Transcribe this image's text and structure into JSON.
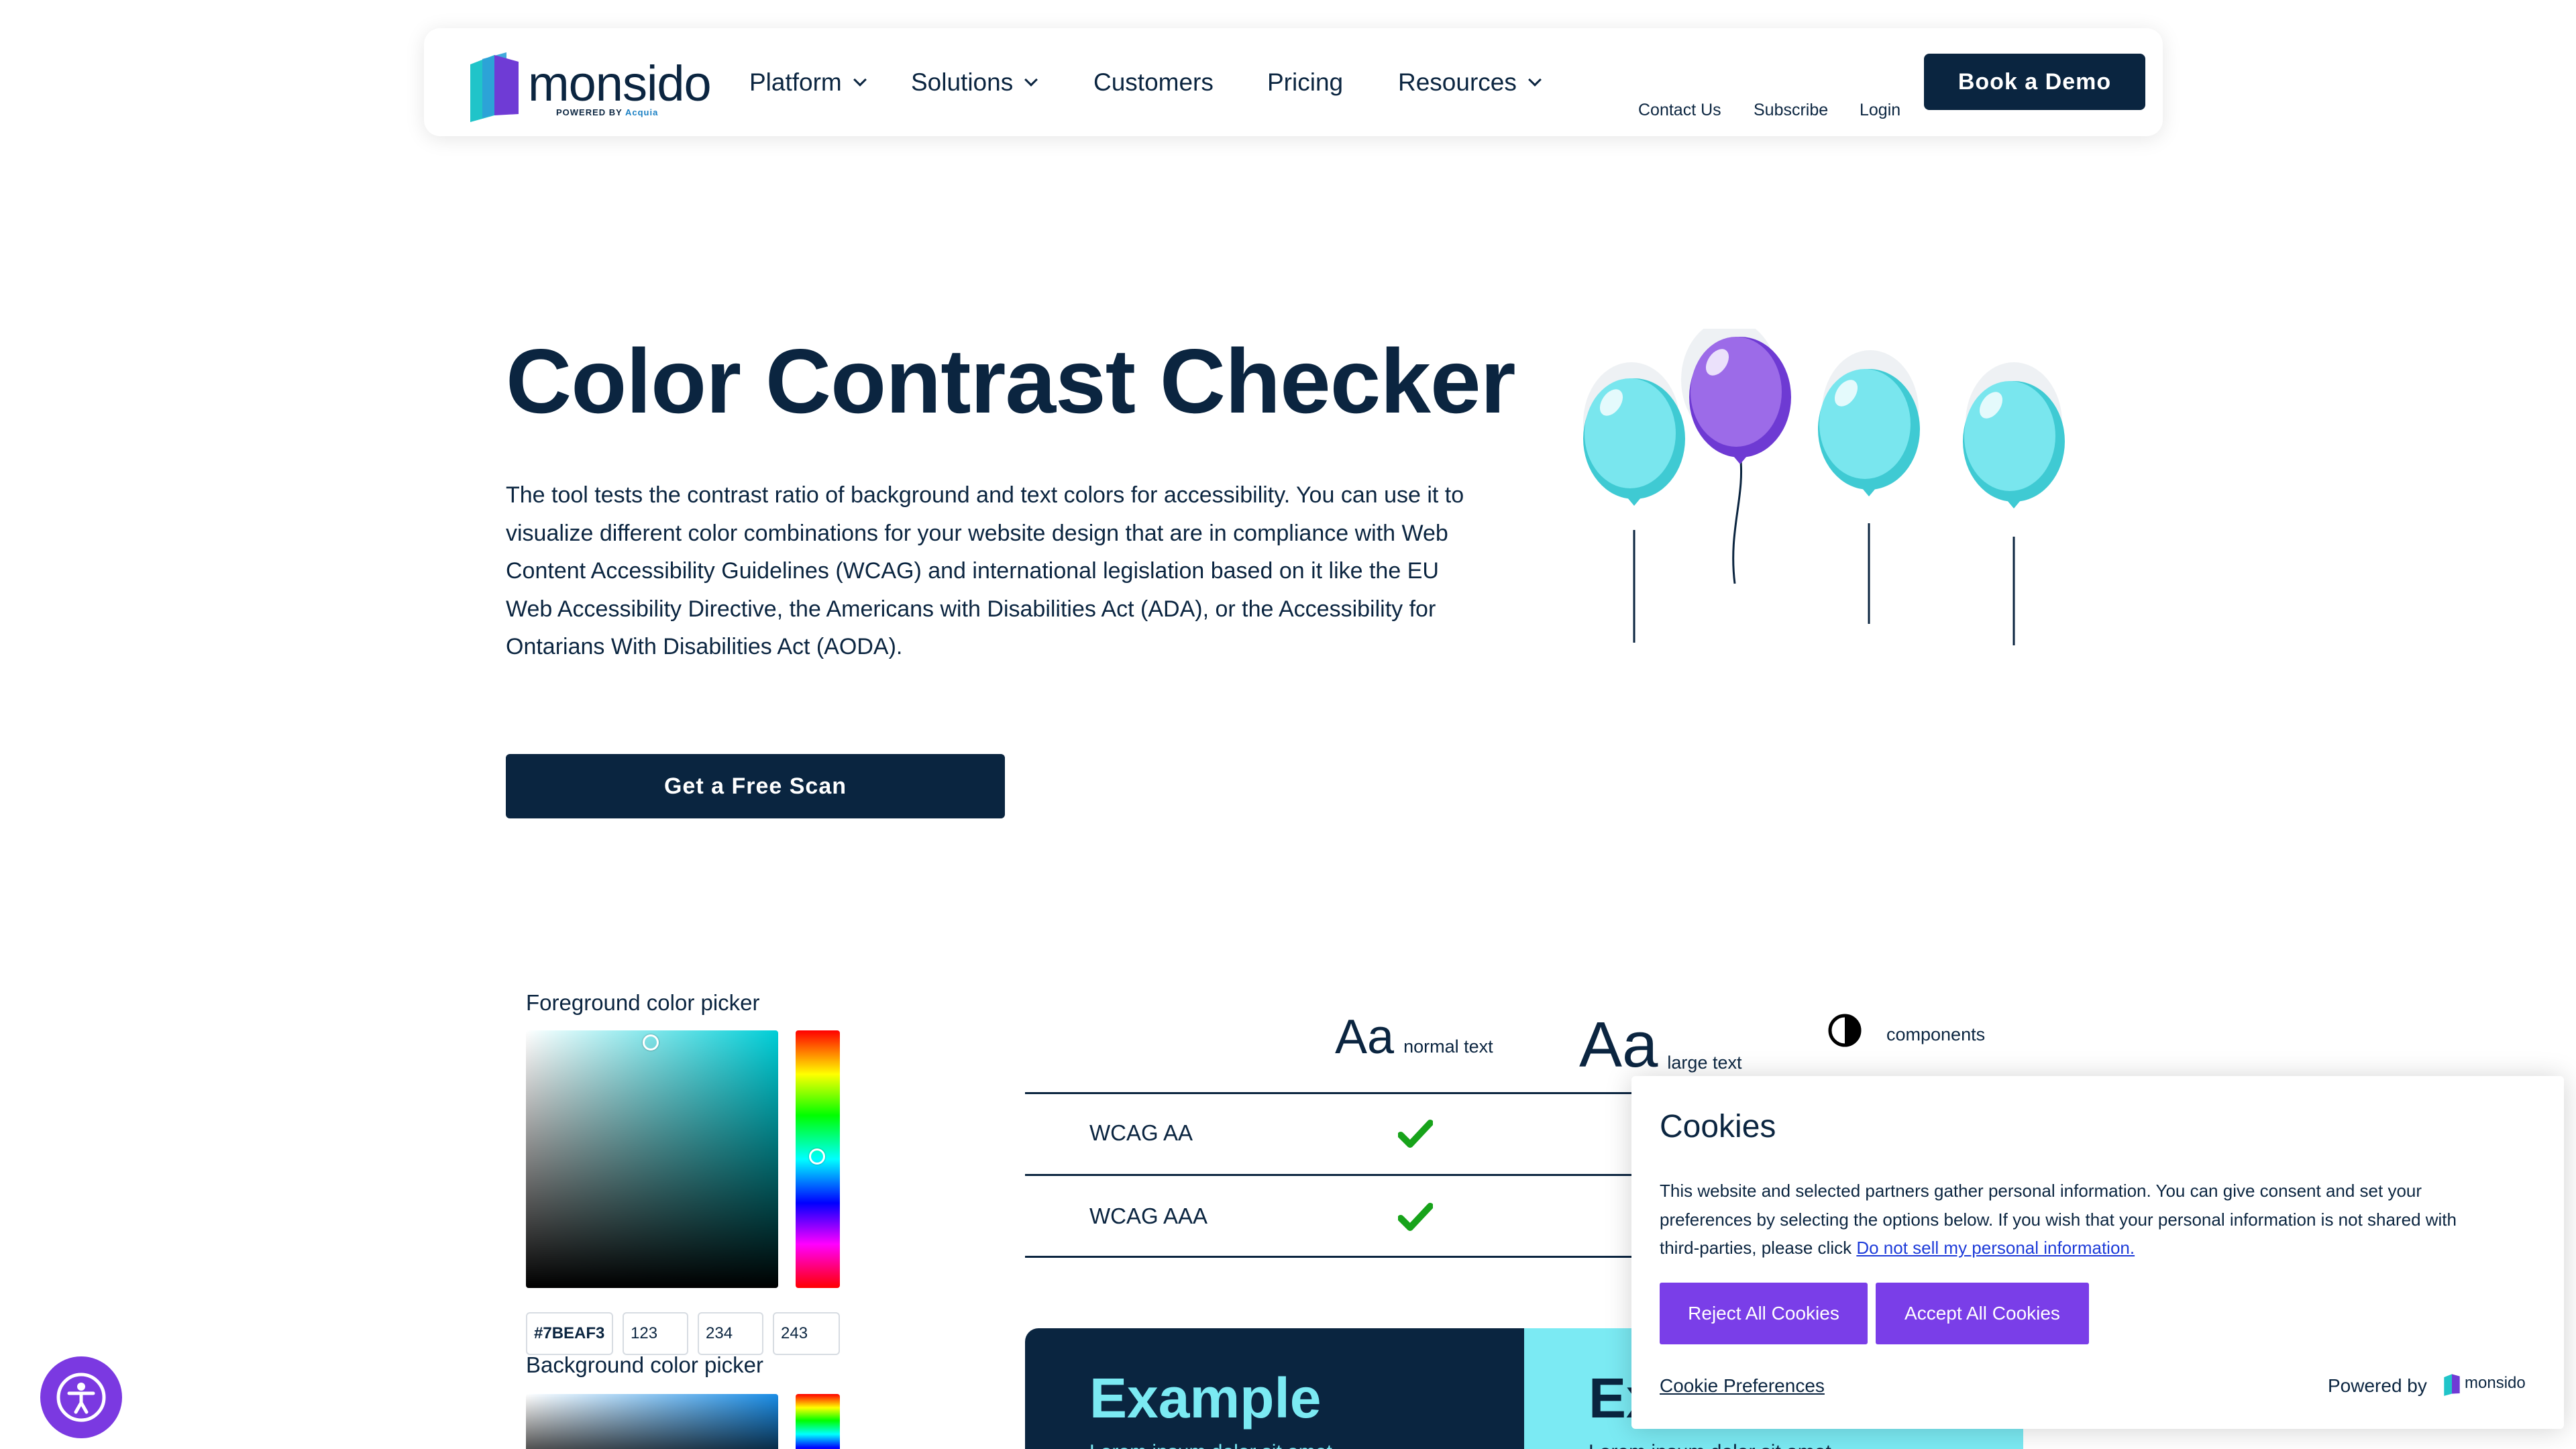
{
  "header": {
    "logo": {
      "wordmark": "monsido",
      "powered_prefix": "POWERED BY",
      "powered_brand": "Acquia"
    },
    "nav": [
      {
        "label": "Platform",
        "has_dropdown": true
      },
      {
        "label": "Solutions",
        "has_dropdown": true
      },
      {
        "label": "Customers",
        "has_dropdown": false
      },
      {
        "label": "Pricing",
        "has_dropdown": false
      },
      {
        "label": "Resources",
        "has_dropdown": true
      }
    ],
    "utility_links": [
      "Contact Us",
      "Subscribe",
      "Login"
    ],
    "cta_label": "Book a Demo"
  },
  "hero": {
    "title": "Color Contrast Checker",
    "description_lines": [
      "The tool tests the contrast ratio of background and text colors for accessibility. You can use it to",
      "visualize different color combinations for your website design that are in compliance with Web",
      "Content Accessibility Guidelines (WCAG) and international legislation based on it like the EU",
      "Web Accessibility Directive, the Americans with Disabilities Act (ADA), or the Accessibility for",
      "Ontarians With Disabilities Act (AODA)."
    ],
    "cta_label": "Get a Free Scan",
    "illustration": "balloons-illustration"
  },
  "foreground_picker": {
    "label": "Foreground color picker",
    "hex": "#7BEAF3",
    "r": "123",
    "g": "234",
    "b": "243"
  },
  "background_picker": {
    "label": "Background color picker"
  },
  "results": {
    "columns": [
      {
        "glyph": "Aa",
        "label": "normal text"
      },
      {
        "glyph": "Aa",
        "label": "large text"
      },
      {
        "glyph": "contrast-icon",
        "label": "components"
      }
    ],
    "rows": [
      {
        "label": "WCAG AA",
        "normal_pass": true
      },
      {
        "label": "WCAG AAA",
        "normal_pass": true
      }
    ]
  },
  "examples": [
    {
      "title": "Example",
      "text": "Lorem ipsum dolor sit amet",
      "bg": "#0a2540",
      "fg": "#7beaf3"
    },
    {
      "title": "Ex",
      "text": "Lorem ipsum dolor sit amet",
      "bg": "#7beaf3",
      "fg": "#0a2540"
    }
  ],
  "cookie_banner": {
    "title": "Cookies",
    "body_lines": [
      "This website and selected partners gather personal information. You can give consent and set your",
      "preferences by selecting the options below. If you wish that your personal information is not shared with",
      "third-parties, please click "
    ],
    "link_text": "Do not sell my personal information.",
    "reject_label": "Reject All Cookies",
    "accept_label": "Accept All Cookies",
    "preferences_label": "Cookie Preferences",
    "powered_by": "Powered by",
    "powered_brand": "monsido"
  },
  "colors": {
    "navy": "#0a2540",
    "cyan": "#7beaf3",
    "purple": "#7a3ee8",
    "check_green": "#17a31a"
  },
  "accessibility_button_icon": "accessibility-person-icon"
}
